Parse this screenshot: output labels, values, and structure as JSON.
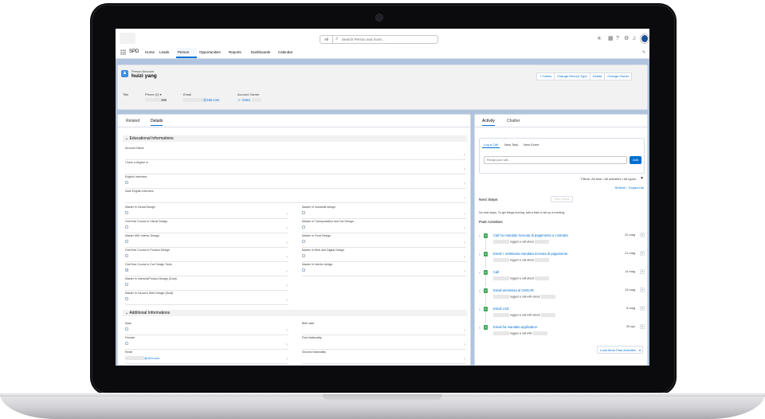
{
  "app": {
    "name": "SPD",
    "search_scope": "All",
    "search_placeholder": "Search Person and more...",
    "nav": [
      {
        "label": "Home"
      },
      {
        "label": "Leads"
      },
      {
        "label": "Person"
      },
      {
        "label": "Opportunities"
      },
      {
        "label": "Reports"
      },
      {
        "label": "Dashboards"
      },
      {
        "label": "Calendar"
      }
    ],
    "icons": [
      "star-icon",
      "waffle-icon",
      "help-icon",
      "gear-icon",
      "bell-icon",
      "avatar"
    ]
  },
  "record": {
    "type": "Person Account",
    "name": "huizi yang",
    "buttons": [
      "+ Follow",
      "Change Record Type",
      "Delete",
      "Change Owner"
    ],
    "fields": {
      "title_label": "Title",
      "phone_label": "Phone (2) ▾",
      "phone_value": "194",
      "email_label": "Email",
      "email_value": "@163.com",
      "owner_label": "Account Owner",
      "owner_value": "Grato"
    }
  },
  "details": {
    "tabs": [
      "Related",
      "Details"
    ],
    "section1": "Educational Informations",
    "account_name_label": "Account Name",
    "f": [
      "I have a degree in",
      "English Interview",
      "Note English Interview",
      "Master in Visual Design",
      "Master in Industrial design",
      "OneYear Course in Visual Design",
      "Master in Transportation and Car Design",
      "Master MID Interior Design",
      "Master in Food Design",
      "OneYear Course in Product Design",
      "Master in Web and Digital Design",
      "OneYear Course in Car Design Tools",
      "Master in Interior design",
      "Master in Interior&Product Design (Dual)",
      "Master in Visual & Web Design (Dual)"
    ],
    "section2": "Additional Informations",
    "g": [
      "Male",
      "Birth date",
      "Female",
      "First Nationality",
      "Email",
      "Second Nationality"
    ],
    "email_value": "@163.com"
  },
  "activity": {
    "tabs": [
      "Activity",
      "Chatter"
    ],
    "subtabs": [
      "Log a Call",
      "New Task",
      "New Event"
    ],
    "recap_placeholder": "Recap your call...",
    "add_label": "Add",
    "filters": "Filters: All time • All activities • All types",
    "refresh": "Refresh · Expand All",
    "next_steps": "Next Steps",
    "more_steps": "More Steps",
    "no_steps": "No next steps. To get things moving, add a task or set up a meeting.",
    "past": "Past Activities",
    "items": [
      {
        "title": "Call ha mandato ricevuta di pagamento a contratto",
        "desc": "logged a call about",
        "date": "22-mag"
      },
      {
        "title": "Email + settimana mandata ricevuta di pagamento",
        "desc": "logged a call about",
        "date": "21-mag"
      },
      {
        "title": "Call",
        "desc": "logged a call about",
        "date": "14-mag"
      },
      {
        "title": "Email ammessa al CMGAR",
        "desc": "logged a call with  about",
        "date": "13-mag"
      },
      {
        "title": "Email LSS",
        "desc": "logged a call with  about",
        "date": "8-mag"
      },
      {
        "title": "Email ha mandato application",
        "desc": "logged a call with",
        "date": "30-apr"
      }
    ],
    "load_more": "Load More Past Activities"
  }
}
